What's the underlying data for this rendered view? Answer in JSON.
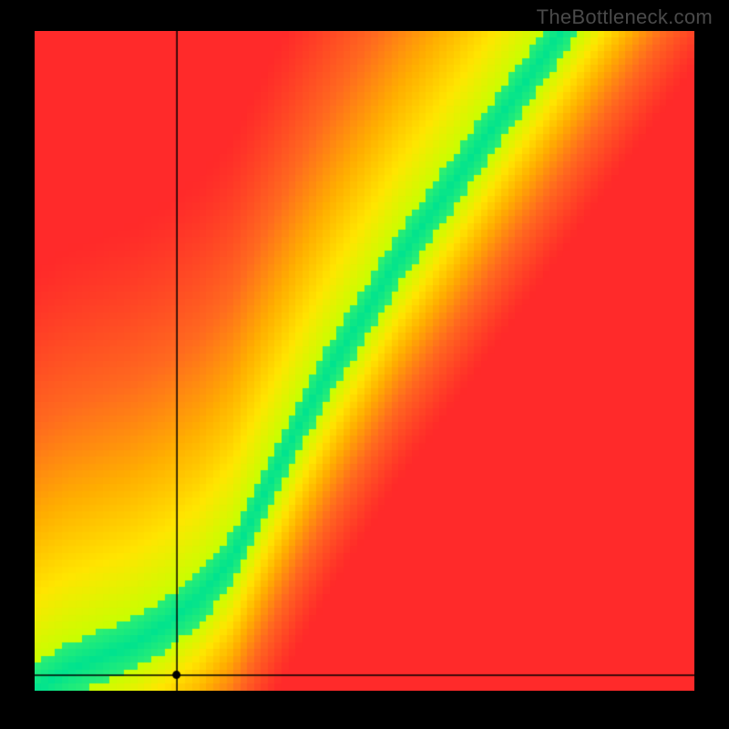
{
  "watermark": "TheBottleneck.com",
  "chart_data": {
    "type": "heatmap",
    "title": "",
    "xlabel": "",
    "ylabel": "",
    "xlim": [
      0,
      1
    ],
    "ylim": [
      0,
      1
    ],
    "grid": false,
    "legend": false,
    "crosshair": {
      "x": 0.215,
      "y": 0.024
    },
    "ridge": {
      "description": "Peak (best-match) path across the field as (x, y_center) pairs, normalized 0–1. Origin is bottom-left.",
      "points": [
        [
          0.0,
          0.0
        ],
        [
          0.05,
          0.03
        ],
        [
          0.1,
          0.05
        ],
        [
          0.15,
          0.07
        ],
        [
          0.2,
          0.1
        ],
        [
          0.25,
          0.14
        ],
        [
          0.3,
          0.2
        ],
        [
          0.35,
          0.3
        ],
        [
          0.4,
          0.4
        ],
        [
          0.45,
          0.49
        ],
        [
          0.5,
          0.57
        ],
        [
          0.55,
          0.65
        ],
        [
          0.6,
          0.72
        ],
        [
          0.65,
          0.79
        ],
        [
          0.7,
          0.86
        ],
        [
          0.75,
          0.93
        ],
        [
          0.8,
          1.0
        ]
      ]
    },
    "ridge_halfwidth": 0.04,
    "falloff": {
      "description": "Approximate normalized distance from the ridge at which the field turns fully red on each side.",
      "left": 0.3,
      "right": 0.6
    },
    "colormap": {
      "stops": [
        [
          0.0,
          "#ff2a2a"
        ],
        [
          0.25,
          "#ff6a1f"
        ],
        [
          0.45,
          "#ffb000"
        ],
        [
          0.62,
          "#ffe600"
        ],
        [
          0.78,
          "#c8ff00"
        ],
        [
          0.88,
          "#6bff4d"
        ],
        [
          1.0,
          "#00e38f"
        ]
      ]
    },
    "pixelation": 96
  }
}
